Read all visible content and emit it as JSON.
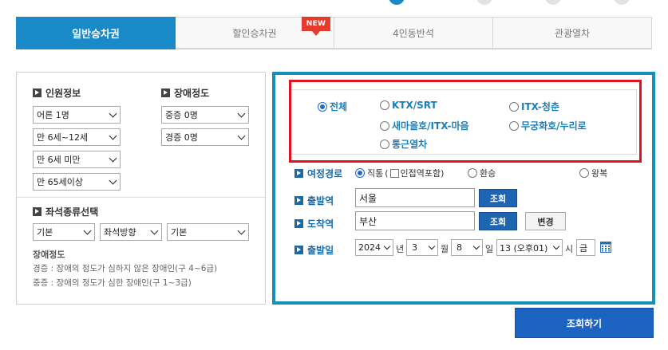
{
  "tabs": [
    {
      "label": "일반승차권",
      "active": true
    },
    {
      "label": "할인승차권",
      "badge": "NEW"
    },
    {
      "label": "4인동반석"
    },
    {
      "label": "관광열차"
    }
  ],
  "passengers": {
    "title": "인원정보",
    "adult": "어른 1명",
    "child": "만 6세~12세",
    "toddler": "만 6세 미만",
    "senior": "만 65세이상"
  },
  "disability": {
    "title": "장애정도",
    "severe": "중증 0명",
    "mild": "경증 0명"
  },
  "seat": {
    "title": "좌석종류선택",
    "type": "기본",
    "direction": "좌석방향",
    "position": "기본"
  },
  "note": {
    "title": "장애정도",
    "mild_desc": "경증 : 장애의 정도가 심하지 않은 장애인(구 4~6급)",
    "severe_desc": "중증 : 장애의 정도가 심한 장애인(구 1~3급)"
  },
  "train_types": [
    {
      "label": "전체",
      "selected": true
    },
    {
      "label": "KTX/SRT"
    },
    {
      "label": "ITX-청춘"
    },
    {
      "label": "새마을호/ITX-마음"
    },
    {
      "label": "무궁화호/누리로"
    },
    {
      "label": "통근열차"
    }
  ],
  "route": {
    "label": "여정경로",
    "direct": "직통",
    "include_transfer": "인접역포함",
    "transfer": "환승",
    "round_trip": "왕복"
  },
  "departure": {
    "label": "출발역",
    "value": "서울",
    "lookup": "조회"
  },
  "arrival": {
    "label": "도착역",
    "value": "부산",
    "lookup": "조회",
    "swap": "변경"
  },
  "date": {
    "label": "출발일",
    "year": "2024",
    "year_unit": "년",
    "month": "3",
    "month_unit": "월",
    "day": "8",
    "day_unit": "일",
    "weekday": "13 (오후01)",
    "hour_unit": "시",
    "weekday_short": "금"
  },
  "search_button": "조회하기",
  "colors": {
    "accent": "#1a89c8",
    "frame": "#1a8fb5",
    "highlight": "#e0141e",
    "button": "#1c63c2"
  }
}
